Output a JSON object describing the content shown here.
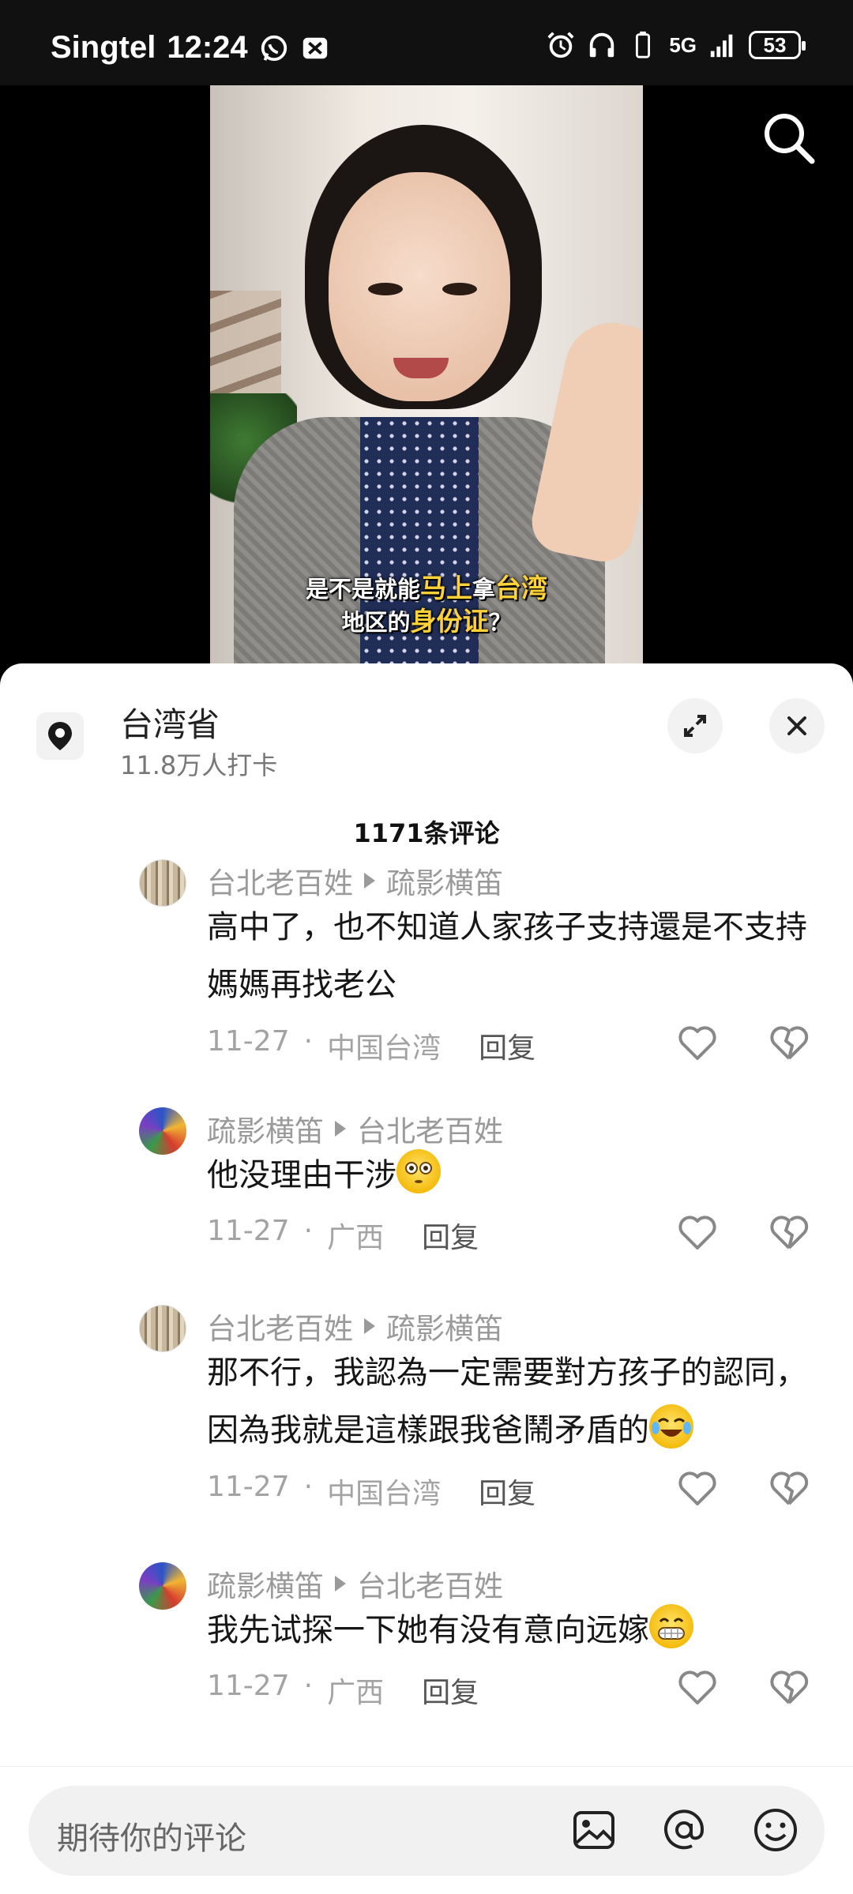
{
  "status_bar": {
    "carrier": "Singtel",
    "time": "12:24",
    "network": "5G",
    "battery": "53"
  },
  "video": {
    "caption_line1_a": "是不是就能",
    "caption_line1_hl1": "马上",
    "caption_line1_b": "拿",
    "caption_line1_hl2": "台湾",
    "caption_line2_a": "地区的",
    "caption_line2_hl": "身份证",
    "caption_line2_b": "？"
  },
  "location": {
    "title": "台湾省",
    "subtitle": "11.8万人打卡"
  },
  "comments_header": "1171条评论",
  "comments": [
    {
      "author": "台北老百姓",
      "reply_to": "疏影横笛",
      "text": "高中了，也不知道人家孩子支持還是不支持媽媽再找老公",
      "date": "11-27",
      "region": "中国台湾",
      "reply_label": "回复",
      "avatar": "a"
    },
    {
      "author": "疏影横笛",
      "reply_to": "台北老百姓",
      "text": "他没理由干涉",
      "emoji": "flushed-face",
      "date": "11-27",
      "region": "广西",
      "reply_label": "回复",
      "avatar": "b"
    },
    {
      "author": "台北老百姓",
      "reply_to": "疏影横笛",
      "text": "那不行，我認為一定需要對方孩子的認同，因為我就是這樣跟我爸鬧矛盾的",
      "emoji": "rofl-face",
      "date": "11-27",
      "region": "中国台湾",
      "reply_label": "回复",
      "avatar": "a"
    },
    {
      "author": "疏影横笛",
      "reply_to": "台北老百姓",
      "text": "我先试探一下她有没有意向远嫁",
      "emoji": "grinning-face",
      "date": "11-27",
      "region": "广西",
      "reply_label": "回复",
      "avatar": "b"
    }
  ],
  "input": {
    "placeholder": "期待你的评论"
  },
  "colors": {
    "caption_highlight": "#ffd23a",
    "muted_text": "#9a9a9a",
    "sheet_bg": "#ffffff"
  }
}
